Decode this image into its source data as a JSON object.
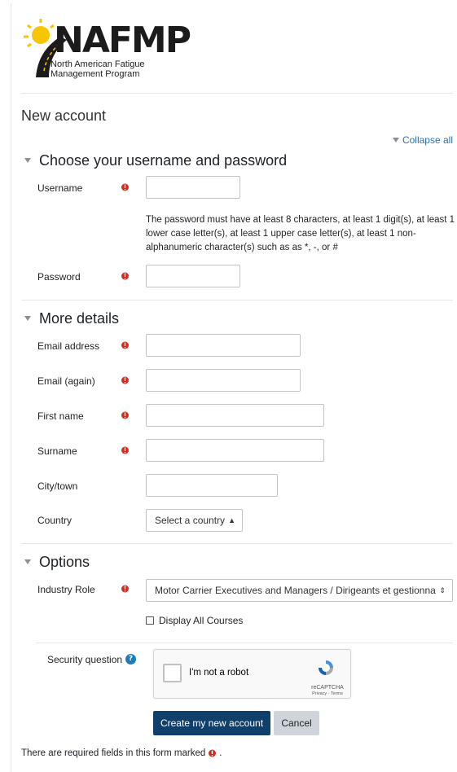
{
  "brand": {
    "wordmark": "NAFMP",
    "subtitle_line1": "North American Fatigue",
    "subtitle_line2": "Management Program",
    "colors": {
      "sun": "#f7c600",
      "road": "#1b1b1b"
    }
  },
  "page": {
    "title": "New account",
    "collapse_all": "Collapse all"
  },
  "sections": {
    "credentials": {
      "heading": "Choose your username and password",
      "username_label": "Username",
      "username_value": "",
      "password_policy": "The password must have at least 8 characters, at least 1 digit(s), at least 1 lower case letter(s), at least 1 upper case letter(s), at least 1 non-alphanumeric character(s) such as as *, -, or #",
      "password_label": "Password",
      "password_value": ""
    },
    "details": {
      "heading": "More details",
      "email_label": "Email address",
      "email_again_label": "Email (again)",
      "first_name_label": "First name",
      "surname_label": "Surname",
      "city_label": "City/town",
      "country_label": "Country",
      "country_selected": "Select a country"
    },
    "options": {
      "heading": "Options",
      "industry_role_label": "Industry Role",
      "industry_role_selected": "Motor Carrier Executives and Managers / Dirigeants et gestionna",
      "display_all_courses": "Display All Courses"
    }
  },
  "security": {
    "label": "Security question",
    "captcha_text": "I'm not a robot",
    "captcha_brand": "reCAPTCHA",
    "captcha_terms": "Privacy - Terms"
  },
  "actions": {
    "create": "Create my new account",
    "cancel": "Cancel"
  },
  "footer": {
    "required_note": "There are required fields in this form marked",
    "required_note_end": "."
  },
  "colors": {
    "required": "#ca3120",
    "primary_button": "#0f3f6b",
    "link": "#2f6fa6",
    "help": "#1f7bb5"
  },
  "icons": {
    "required": "exclamation-circle-icon",
    "help": "question-circle-icon",
    "section_toggle": "caret-down-icon",
    "select_arrows": "sort-arrows-icon"
  }
}
